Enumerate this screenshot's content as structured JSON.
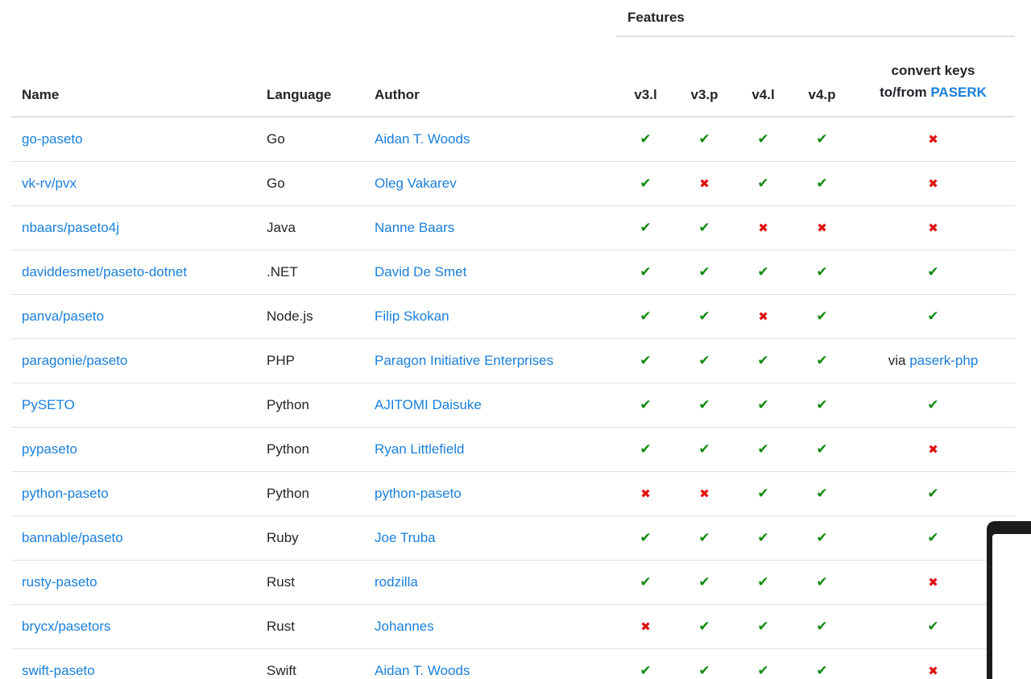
{
  "header": {
    "features_label": "Features",
    "columns": {
      "name": "Name",
      "language": "Language",
      "author": "Author",
      "v3l": "v3.l",
      "v3p": "v3.p",
      "v4l": "v4.l",
      "v4p": "v4.p",
      "convert_line1": "convert keys",
      "convert_line2_prefix": "to/from",
      "convert_link": "PASERK"
    }
  },
  "marks": {
    "yes": "✔",
    "no": "✖"
  },
  "rows": [
    {
      "name": "go-paseto",
      "language": "Go",
      "author": "Aidan T. Woods",
      "v3l": "yes",
      "v3p": "yes",
      "v4l": "yes",
      "v4p": "yes",
      "convert": "no"
    },
    {
      "name": "vk-rv/pvx",
      "language": "Go",
      "author": "Oleg Vakarev",
      "v3l": "yes",
      "v3p": "no",
      "v4l": "yes",
      "v4p": "yes",
      "convert": "no"
    },
    {
      "name": "nbaars/paseto4j",
      "language": "Java",
      "author": "Nanne Baars",
      "v3l": "yes",
      "v3p": "yes",
      "v4l": "no",
      "v4p": "no",
      "convert": "no"
    },
    {
      "name": "daviddesmet/paseto-dotnet",
      "language": ".NET",
      "author": "David De Smet",
      "v3l": "yes",
      "v3p": "yes",
      "v4l": "yes",
      "v4p": "yes",
      "convert": "yes"
    },
    {
      "name": "panva/paseto",
      "language": "Node.js",
      "author": "Filip Skokan",
      "v3l": "yes",
      "v3p": "yes",
      "v4l": "no",
      "v4p": "yes",
      "convert": "yes"
    },
    {
      "name": "paragonie/paseto",
      "language": "PHP",
      "author": "Paragon Initiative Enterprises",
      "v3l": "yes",
      "v3p": "yes",
      "v4l": "yes",
      "v4p": "yes",
      "convert": "via",
      "convert_prefix": "via",
      "convert_link": "paserk-php"
    },
    {
      "name": "PySETO",
      "language": "Python",
      "author": "AJITOMI Daisuke",
      "v3l": "yes",
      "v3p": "yes",
      "v4l": "yes",
      "v4p": "yes",
      "convert": "yes"
    },
    {
      "name": "pypaseto",
      "language": "Python",
      "author": "Ryan Littlefield",
      "v3l": "yes",
      "v3p": "yes",
      "v4l": "yes",
      "v4p": "yes",
      "convert": "no"
    },
    {
      "name": "python-paseto",
      "language": "Python",
      "author": "python-paseto",
      "v3l": "no",
      "v3p": "no",
      "v4l": "yes",
      "v4p": "yes",
      "convert": "yes"
    },
    {
      "name": "bannable/paseto",
      "language": "Ruby",
      "author": "Joe Truba",
      "v3l": "yes",
      "v3p": "yes",
      "v4l": "yes",
      "v4p": "yes",
      "convert": "yes"
    },
    {
      "name": "rusty-paseto",
      "language": "Rust",
      "author": "rodzilla",
      "v3l": "yes",
      "v3p": "yes",
      "v4l": "yes",
      "v4p": "yes",
      "convert": "no"
    },
    {
      "name": "brycx/pasetors",
      "language": "Rust",
      "author": "Johannes",
      "v3l": "no",
      "v3p": "yes",
      "v4l": "yes",
      "v4p": "yes",
      "convert": "yes"
    },
    {
      "name": "swift-paseto",
      "language": "Swift",
      "author": "Aidan T. Woods",
      "v3l": "yes",
      "v3p": "yes",
      "v4l": "yes",
      "v4p": "yes",
      "convert": "no"
    }
  ],
  "colors": {
    "link": "#1a7fdb",
    "yes": "#108a10",
    "no": "#e01010",
    "border": "#dee2e6"
  }
}
